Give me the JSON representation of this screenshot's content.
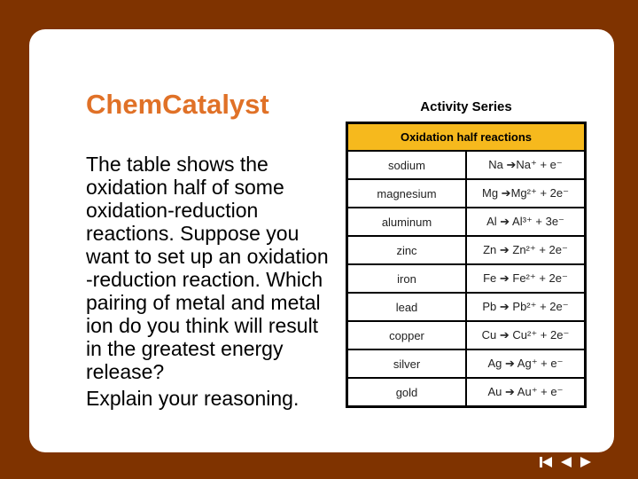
{
  "header": {
    "title": "ChemCatalyst"
  },
  "prompt": {
    "lines": [
      "The table shows the",
      "oxidation half of some",
      "oxidation-reduction",
      "reactions. Suppose you",
      "want to set up an oxidation",
      "-reduction reaction. Which",
      "pairing of metal and metal",
      "ion do you think will result",
      "in the greatest energy",
      "release?"
    ],
    "explain": "Explain your reasoning."
  },
  "table": {
    "caption": "Activity Series",
    "header": "Oxidation half reactions",
    "rows": [
      {
        "metal": "sodium",
        "reaction": "Na ➔Na⁺ + e⁻"
      },
      {
        "metal": "magnesium",
        "reaction": "Mg ➔Mg²⁺ + 2e⁻"
      },
      {
        "metal": "aluminum",
        "reaction": "Al ➔ Al³⁺ + 3e⁻"
      },
      {
        "metal": "zinc",
        "reaction": "Zn ➔ Zn²⁺ + 2e⁻"
      },
      {
        "metal": "iron",
        "reaction": "Fe ➔ Fe²⁺ + 2e⁻"
      },
      {
        "metal": "lead",
        "reaction": "Pb ➔ Pb²⁺ + 2e⁻"
      },
      {
        "metal": "copper",
        "reaction": "Cu ➔ Cu²⁺ + 2e⁻"
      },
      {
        "metal": "silver",
        "reaction": "Ag ➔ Ag⁺ + e⁻"
      },
      {
        "metal": "gold",
        "reaction": "Au ➔ Au⁺ + e⁻"
      }
    ]
  },
  "navigation": {
    "icons": [
      "first-slide-icon",
      "previous-slide-icon",
      "next-slide-icon"
    ]
  },
  "colors": {
    "background": "#7f3300",
    "title": "#e07127",
    "table_header": "#f6b91d"
  }
}
